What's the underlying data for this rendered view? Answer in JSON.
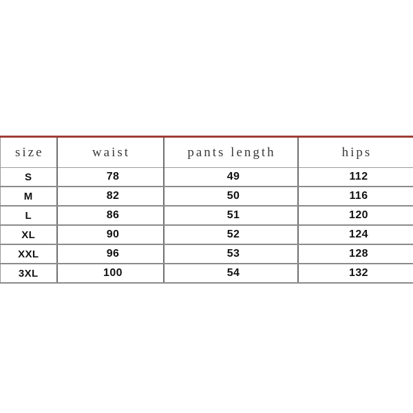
{
  "table": {
    "name": "size-chart",
    "columns": [
      "size",
      "waist",
      "pants length",
      "hips"
    ],
    "rows": [
      {
        "size": "S",
        "waist": "78",
        "pants_length": "49",
        "hips": "112"
      },
      {
        "size": "M",
        "waist": "82",
        "pants_length": "50",
        "hips": "116"
      },
      {
        "size": "L",
        "waist": "86",
        "pants_length": "51",
        "hips": "120"
      },
      {
        "size": "XL",
        "waist": "90",
        "pants_length": "52",
        "hips": "124"
      },
      {
        "size": "XXL",
        "waist": "96",
        "pants_length": "53",
        "hips": "128"
      },
      {
        "size": "3XL",
        "waist": "100",
        "pants_length": "54",
        "hips": "132"
      }
    ],
    "colors": {
      "top_border": "#a03c34",
      "grid_line": "#8a8a8a",
      "column_divider": "#6e6e6e",
      "background": "#ffffff",
      "header_text": "#3a3a3a",
      "data_text": "#111111"
    }
  }
}
